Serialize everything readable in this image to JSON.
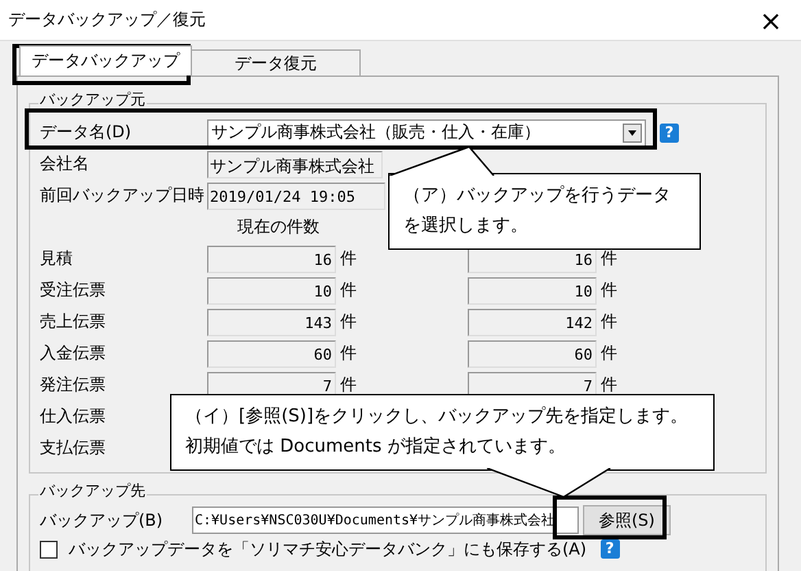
{
  "window": {
    "title": "データバックアップ／復元",
    "close": "×"
  },
  "tabs": [
    {
      "label": "データバックアップ",
      "selected": true
    },
    {
      "label": "データ復元",
      "selected": false
    }
  ],
  "source_group": {
    "title": "バックアップ元",
    "data_name": {
      "label": "データ名(D)",
      "value": "サンプル商事株式会社（販売・仕入・在庫）",
      "help": "?"
    },
    "company": {
      "label": "会社名",
      "value": "サンプル商事株式会社"
    },
    "last_backup": {
      "label": "前回バックアップ日時",
      "value": "2019/01/24 19:05"
    },
    "counts_header": "現在の件数",
    "counts": [
      {
        "label": "見積",
        "current": "16",
        "unit": "件",
        "column_2": "16",
        "unit_2": "件"
      },
      {
        "label": "受注伝票",
        "current": "10",
        "unit": "件",
        "column_2": "10",
        "unit_2": "件"
      },
      {
        "label": "売上伝票",
        "current": "143",
        "unit": "件",
        "column_2": "142",
        "unit_2": "件"
      },
      {
        "label": "入金伝票",
        "current": "60",
        "unit": "件",
        "column_2": "60",
        "unit_2": "件"
      },
      {
        "label": "発注伝票",
        "current": "7",
        "unit": "件",
        "column_2": "7",
        "unit_2": "件"
      },
      {
        "label": "仕入伝票"
      },
      {
        "label": "支払伝票"
      }
    ]
  },
  "destination_group": {
    "title": "バックアップ先",
    "label": "バックアップ(B)",
    "path": "C:¥Users¥NSC030U¥Documents¥サンプル商事株式会社",
    "browse_button": "参照(S)",
    "checkbox": {
      "label": "バックアップデータを「ソリマチ安心データバンク」にも保存する(A)",
      "checked": false,
      "help": "?"
    }
  },
  "callouts": [
    {
      "kind": "up",
      "lines": [
        "（ア）バックアップを行うデータ",
        "を選択します。"
      ]
    },
    {
      "kind": "down",
      "lines": [
        "（イ）[参照(S)]をクリックし、バックアップ先を指定します。",
        "初期値では Documents が指定されています。"
      ]
    }
  ]
}
